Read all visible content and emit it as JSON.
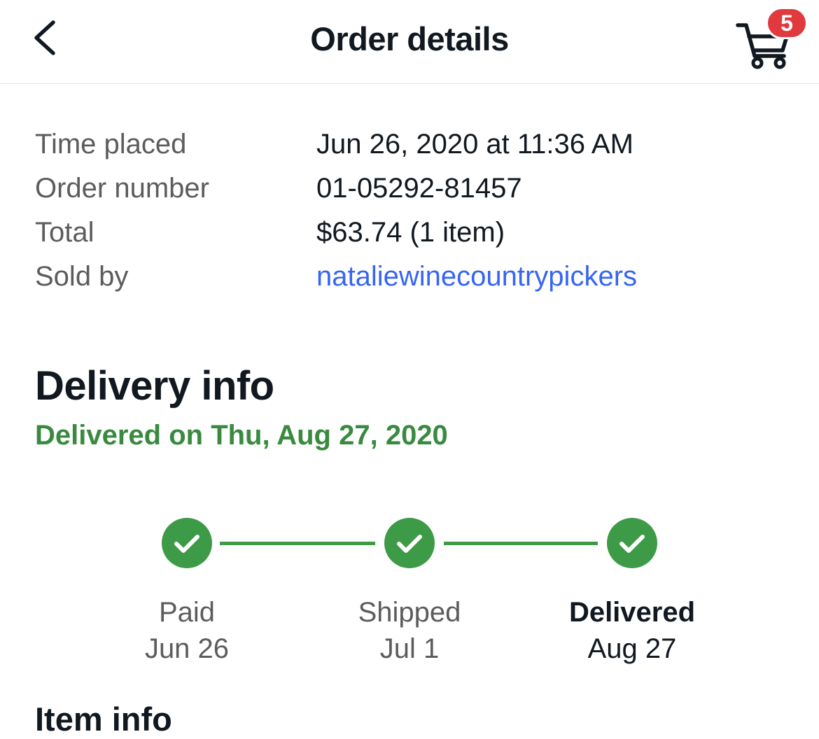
{
  "header": {
    "title": "Order details",
    "back_icon": "chevron-left-icon",
    "cart_icon": "cart-icon",
    "cart_count": "5"
  },
  "summary": {
    "rows": [
      {
        "label": "Time placed",
        "value": "Jun 26, 2020 at 11:36 AM"
      },
      {
        "label": "Order number",
        "value": "01-05292-81457"
      },
      {
        "label": "Total",
        "value": "$63.74 (1 item)"
      },
      {
        "label": "Sold by",
        "value": "nataliewinecountrypickers"
      }
    ]
  },
  "delivery": {
    "title": "Delivery info",
    "status": "Delivered on Thu, Aug 27, 2020",
    "steps": [
      {
        "label": "Paid",
        "date": "Jun 26"
      },
      {
        "label": "Shipped",
        "date": "Jul 1"
      },
      {
        "label": "Delivered",
        "date": "Aug 27"
      }
    ]
  },
  "item_info": {
    "title": "Item info"
  },
  "colors": {
    "accent_green": "#3d9a46",
    "status_green": "#398a3f",
    "link_blue": "#3665f3",
    "badge_red": "#e0393e"
  }
}
